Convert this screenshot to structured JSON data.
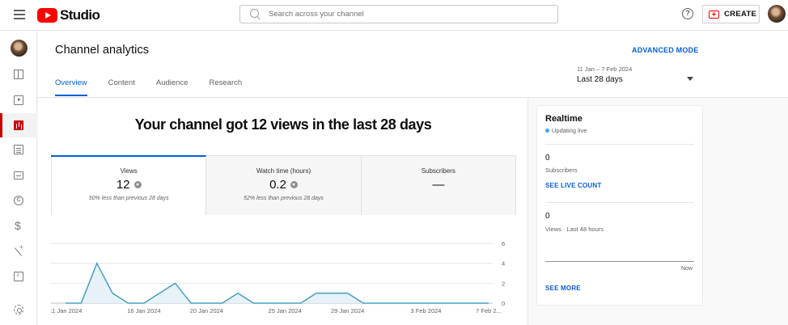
{
  "topbar": {
    "logo_text": "Studio",
    "search_placeholder": "Search across your channel",
    "help_glyph": "?",
    "create_label": "CREATE"
  },
  "sidebar": {
    "items": [
      {
        "icon": "dashboard-icon"
      },
      {
        "icon": "content-icon"
      },
      {
        "icon": "analytics-icon",
        "active": true
      },
      {
        "icon": "comments-icon"
      },
      {
        "icon": "subtitles-icon"
      },
      {
        "icon": "copyright-icon",
        "glyph": "C"
      },
      {
        "icon": "earn-icon",
        "glyph": "$"
      },
      {
        "icon": "customisation-icon"
      },
      {
        "icon": "audio-library-icon"
      },
      {
        "icon": "settings-icon"
      }
    ]
  },
  "header": {
    "title": "Channel analytics",
    "advanced_mode": "ADVANCED MODE",
    "tabs": [
      "Overview",
      "Content",
      "Audience",
      "Research"
    ],
    "date_range": "11 Jan – 7 Feb 2024",
    "date_label": "Last 28 days"
  },
  "main": {
    "headline": "Your channel got 12 views in the last 28 days",
    "metrics": [
      {
        "label": "Views",
        "value": "12",
        "note": "50% less than previous 28 days"
      },
      {
        "label": "Watch time (hours)",
        "value": "0.2",
        "note": "52% less than previous 28 days"
      },
      {
        "label": "Subscribers",
        "value": "—",
        "note": ""
      }
    ]
  },
  "realtime": {
    "title": "Realtime",
    "status": "Updating live",
    "subscribers_value": "0",
    "subscribers_label": "Subscribers",
    "live_count_link": "SEE LIVE COUNT",
    "views_value": "0",
    "views_label": "Views · Last 48 hours",
    "axis_now": "Now",
    "see_more": "SEE MORE"
  },
  "colors": {
    "accent": "#065fd4",
    "brand_red": "#ff0000",
    "line": "#4a9ebd",
    "fill": "#e6f2f8"
  },
  "chart_data": {
    "type": "area",
    "x": [
      "11 Jan 2024",
      "12 Jan",
      "13 Jan",
      "14 Jan",
      "15 Jan",
      "16 Jan 2024",
      "17 Jan",
      "18 Jan",
      "19 Jan",
      "20 Jan 2024",
      "21 Jan",
      "22 Jan",
      "23 Jan",
      "24 Jan",
      "25 Jan 2024",
      "26 Jan",
      "27 Jan",
      "28 Jan",
      "29 Jan 2024",
      "30 Jan",
      "31 Jan",
      "1 Feb",
      "2 Feb",
      "3 Feb 2024",
      "4 Feb",
      "5 Feb",
      "6 Feb",
      "7 Feb 2024"
    ],
    "series": [
      {
        "values": [
          0,
          0,
          4,
          1,
          0,
          0,
          1,
          2,
          0,
          0,
          0,
          1,
          0,
          0,
          0,
          0,
          1,
          1,
          1,
          0,
          0,
          0,
          0,
          0,
          0,
          0,
          0,
          0
        ]
      }
    ],
    "x_tick_labels": [
      "11 Jan 2024",
      "16 Jan 2024",
      "20 Jan 2024",
      "25 Jan 2024",
      "29 Jan 2024",
      "3 Feb 2024",
      "7 Feb 2..."
    ],
    "x_tick_indices": [
      0,
      5,
      9,
      14,
      18,
      23,
      27
    ],
    "y_ticks": [
      "6",
      "4",
      "2",
      "0"
    ],
    "ylim": [
      0,
      6
    ],
    "grid": true
  }
}
